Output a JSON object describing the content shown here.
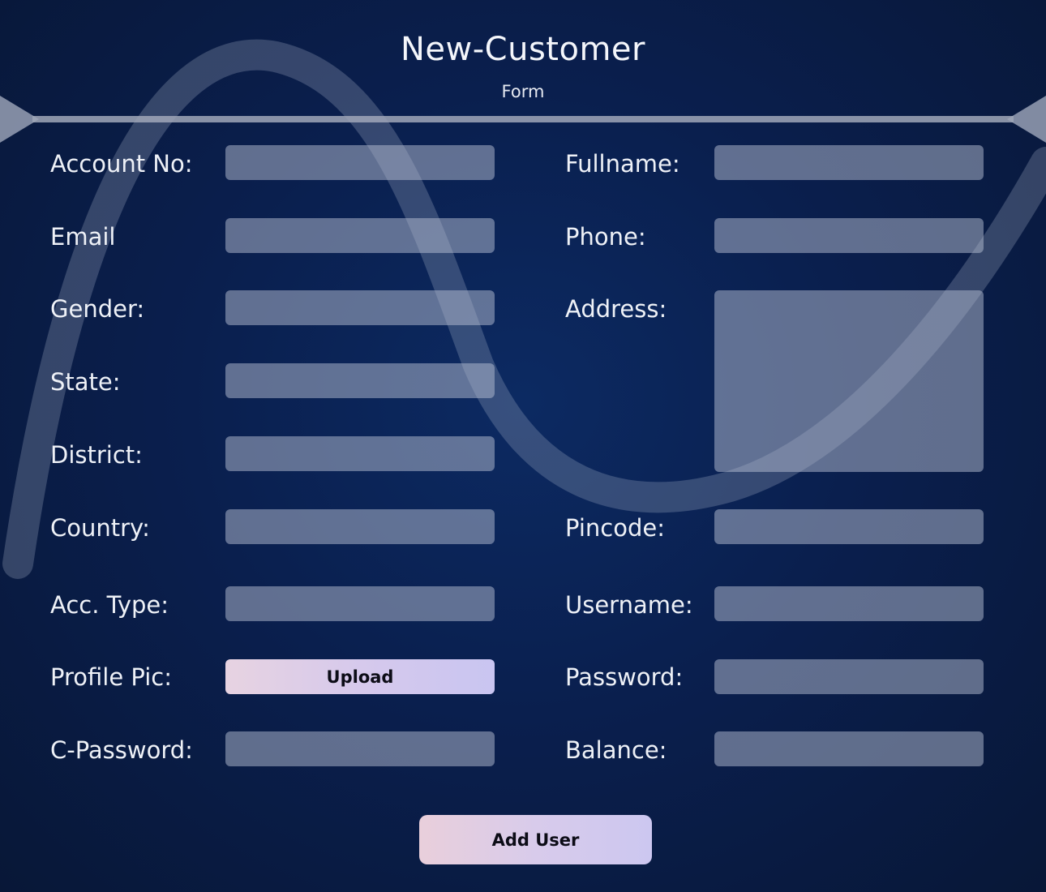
{
  "header": {
    "title": "New-Customer",
    "subtitle": "Form"
  },
  "form": {
    "left_labels": {
      "account_no": "Account No:",
      "email": "Email",
      "gender": "Gender:",
      "state": "State:",
      "district": "District:",
      "country": "Country:",
      "acc_type": "Acc. Type:",
      "profile_pic": "Profile Pic:",
      "c_password": "C-Password:"
    },
    "right_labels": {
      "fullname": "Fullname:",
      "phone": "Phone:",
      "address": "Address:",
      "pincode": "Pincode:",
      "username": "Username:",
      "password": "Password:",
      "balance": "Balance:"
    },
    "values": {
      "account_no": "",
      "email": "",
      "gender": "",
      "state": "",
      "district": "",
      "country": "",
      "acc_type": "",
      "c_password": "",
      "fullname": "",
      "phone": "",
      "address": "",
      "pincode": "",
      "username": "",
      "password": "",
      "balance": ""
    },
    "upload_label": "Upload",
    "submit_label": "Add User"
  },
  "colors": {
    "background": "#0a1f4e",
    "field_fill": "#7a8399",
    "button_gradient_start": "#e7d3e1",
    "button_gradient_end": "#c9c5f1",
    "text": "#eef1f7"
  }
}
